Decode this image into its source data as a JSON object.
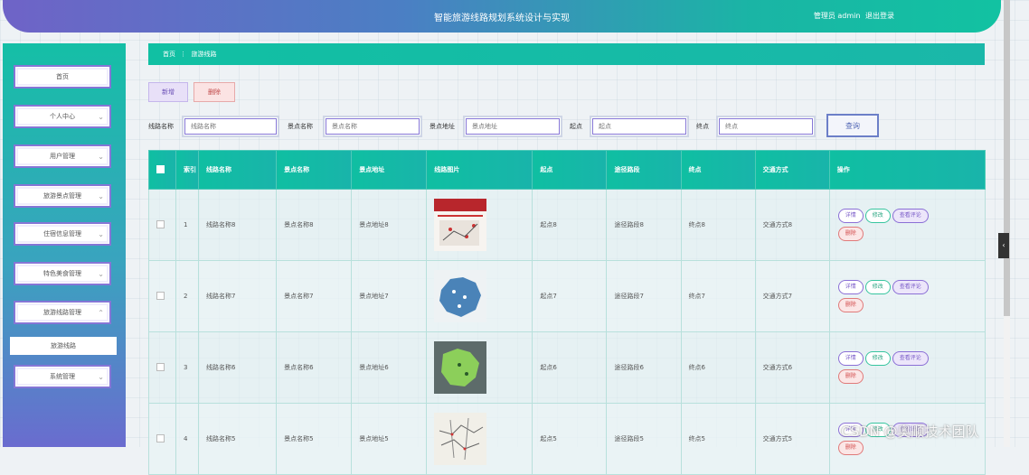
{
  "header": {
    "title": "智能旅游线路规划系统设计与实现",
    "user_role": "管理员 admin",
    "logout": "退出登录"
  },
  "sidebar": {
    "items": [
      {
        "label": "首页",
        "has_chevron": false
      },
      {
        "label": "个人中心",
        "has_chevron": true
      },
      {
        "label": "用户管理",
        "has_chevron": true
      },
      {
        "label": "旅游景点管理",
        "has_chevron": true
      },
      {
        "label": "住宿信息管理",
        "has_chevron": true
      },
      {
        "label": "特色美食管理",
        "has_chevron": true
      },
      {
        "label": "旅游线路管理",
        "has_chevron": true,
        "expanded": true
      },
      {
        "label": "旅游线路",
        "sub": true
      },
      {
        "label": "系统管理",
        "has_chevron": true
      }
    ]
  },
  "breadcrumb": {
    "home": "首页",
    "separator": "⋮",
    "current": "旅游线路"
  },
  "toolbar": {
    "add": "新增",
    "delete": "删除"
  },
  "filters": [
    {
      "label": "线路名称",
      "placeholder": "线路名称"
    },
    {
      "label": "景点名称",
      "placeholder": "景点名称"
    },
    {
      "label": "景点地址",
      "placeholder": "景点地址"
    },
    {
      "label": "起点",
      "placeholder": "起点"
    },
    {
      "label": "终点",
      "placeholder": "终点"
    }
  ],
  "search_button": "查询",
  "table": {
    "columns": [
      "索引",
      "线路名称",
      "景点名称",
      "景点地址",
      "线路图片",
      "起点",
      "途径路段",
      "终点",
      "交通方式",
      "操作"
    ],
    "rows": [
      {
        "index": "1",
        "route": "线路名称8",
        "spot": "景点名称8",
        "address": "景点地址8",
        "image": "route-poster",
        "start": "起点8",
        "via": "途径路段8",
        "end": "终点8",
        "transport": "交通方式8"
      },
      {
        "index": "2",
        "route": "线路名称7",
        "spot": "景点名称7",
        "address": "景点地址7",
        "image": "blue-map",
        "start": "起点7",
        "via": "途径路段7",
        "end": "终点7",
        "transport": "交通方式7"
      },
      {
        "index": "3",
        "route": "线路名称6",
        "spot": "景点名称6",
        "address": "景点地址6",
        "image": "green-map",
        "start": "起点6",
        "via": "途径路段6",
        "end": "终点6",
        "transport": "交通方式6"
      },
      {
        "index": "4",
        "route": "线路名称5",
        "spot": "景点名称5",
        "address": "景点地址5",
        "image": "line-map",
        "start": "起点5",
        "via": "途径路段5",
        "end": "终点5",
        "transport": "交通方式5"
      }
    ],
    "actions": {
      "detail": "详情",
      "edit": "修改",
      "review": "查看评论",
      "delete": "删除"
    }
  },
  "watermark": "CSDN @奥顺技术团队",
  "colors": {
    "accent": "#12c2a2",
    "purple": "#6f63c7"
  }
}
